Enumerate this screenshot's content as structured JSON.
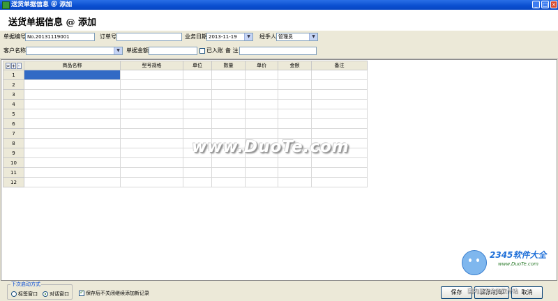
{
  "window": {
    "title": "送货单据信息 ＠ 添加"
  },
  "header": {
    "title": "送货单据信息 @ 添加"
  },
  "form": {
    "doc_no_label": "单据编号",
    "doc_no_value": "No.20131119001",
    "order_no_label": "订单号",
    "order_no_value": "",
    "biz_date_label": "业务日期",
    "biz_date_value": "2013-11-19",
    "handler_label": "经手人",
    "handler_value": "管理员",
    "customer_label": "客户名称",
    "customer_value": "",
    "amount_label": "单据金额",
    "amount_value": "",
    "booked_label": "已入账",
    "note_label": "备 注",
    "note_value": ""
  },
  "grid": {
    "controls": [
      ">",
      "+",
      "-"
    ],
    "columns": [
      "商品名称",
      "型号规格",
      "单位",
      "数量",
      "单价",
      "金额",
      "备注"
    ],
    "rows": [
      "1",
      "2",
      "3",
      "4",
      "5",
      "6",
      "7",
      "8",
      "9",
      "10",
      "11",
      "12"
    ]
  },
  "footer": {
    "startup_group_label": "下次启动方式",
    "option_tab": "标签窗口",
    "option_dialog": "对话窗口",
    "keep_open_label": "保存后不关闭继续添加新记录",
    "save_label": "保存",
    "save_print_label": "保存/打印",
    "cancel_label": "取消"
  },
  "overlays": {
    "watermark": "www.DuoTe.com",
    "logo_brand": "2345软件大全",
    "logo_url": "www.DuoTe.com",
    "slogan": "国内最安全的软件站"
  },
  "colors": {
    "selection": "#316ac5",
    "titlebar": "#0a4fd0"
  }
}
